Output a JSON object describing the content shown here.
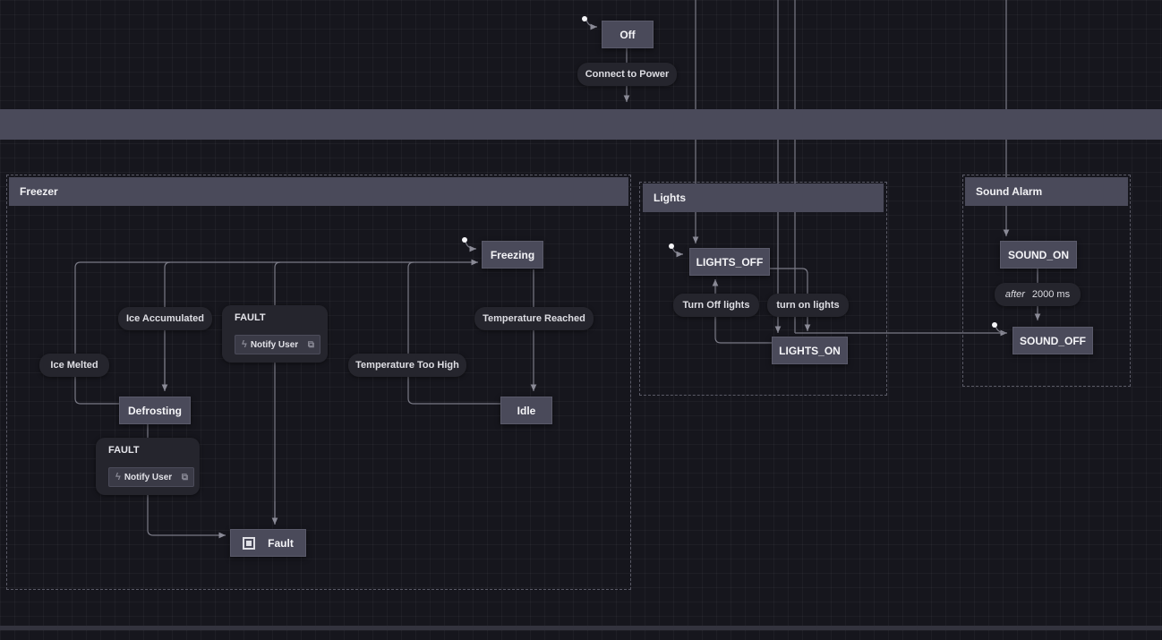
{
  "states": {
    "off": "Off",
    "freezing": "Freezing",
    "defrosting": "Defrosting",
    "idle": "Idle",
    "fault": "Fault",
    "lights_off": "LIGHTS_OFF",
    "lights_on": "LIGHTS_ON",
    "sound_on": "SOUND_ON",
    "sound_off": "SOUND_OFF"
  },
  "regions": {
    "freezer": "Freezer",
    "lights": "Lights",
    "sound_alarm": "Sound Alarm"
  },
  "transitions": {
    "connect_to_power": "Connect to Power",
    "ice_accumulated": "Ice Accumulated",
    "ice_melted": "Ice Melted",
    "temperature_reached": "Temperature Reached",
    "temperature_too_high": "Temperature Too High",
    "turn_off_lights": "Turn Off lights",
    "turn_on_lights": "turn on lights",
    "after_keyword": "after",
    "after_delay": "2000 ms"
  },
  "fault_events": [
    {
      "event": "FAULT",
      "action": "Notify User"
    },
    {
      "event": "FAULT",
      "action": "Notify User"
    }
  ],
  "icons": {
    "action": "lightning-bolt-icon",
    "edit": "edit-icon",
    "final": "final-state-icon",
    "initial": "initial-state-icon"
  },
  "colors": {
    "background": "#16161d",
    "node": "#4a4a5a",
    "label": "#25252d",
    "edge": "#7a7a86"
  }
}
